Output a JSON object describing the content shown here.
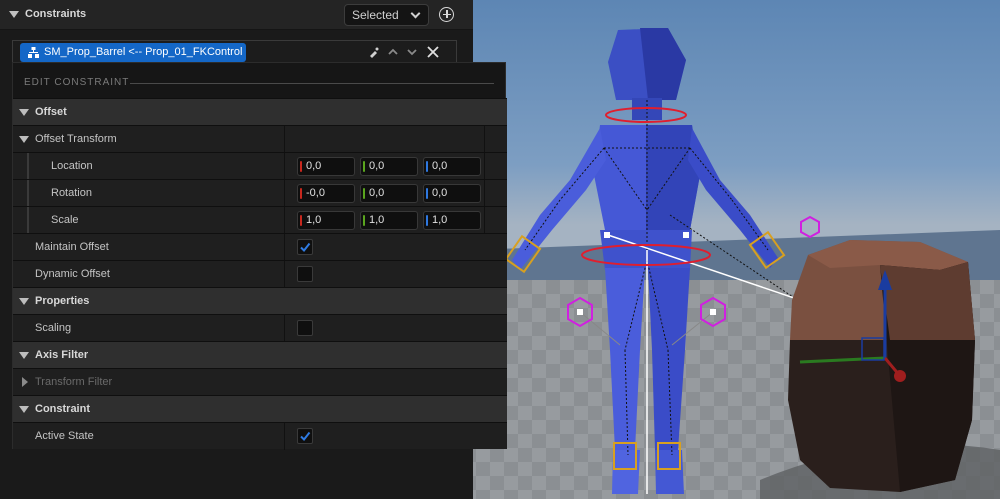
{
  "constraints_panel": {
    "title": "Constraints",
    "filter_dropdown": {
      "value": "Selected"
    },
    "add_icon": "plus-circle-icon",
    "constraint_item": {
      "label": "SM_Prop_Barrel <-- Prop_01_FKControl",
      "icon": "hierarchy-icon",
      "actions": [
        "bake-icon",
        "move-up-icon",
        "move-down-icon",
        "close-icon"
      ]
    }
  },
  "edit_constraint": {
    "title": "EDIT CONSTRAINT",
    "rows": [
      {
        "type": "category",
        "label": "Offset"
      },
      {
        "type": "group",
        "label": "Offset Transform"
      },
      {
        "type": "vector",
        "label": "Location",
        "x": "0,0",
        "y": "0,0",
        "z": "0,0"
      },
      {
        "type": "vector",
        "label": "Rotation",
        "x": "-0,0",
        "y": "0,0",
        "z": "0,0"
      },
      {
        "type": "vector",
        "label": "Scale",
        "x": "1,0",
        "y": "1,0",
        "z": "1,0"
      },
      {
        "type": "bool",
        "label": "Maintain Offset",
        "checked": true
      },
      {
        "type": "bool",
        "label": "Dynamic Offset",
        "checked": false
      },
      {
        "type": "category",
        "label": "Properties"
      },
      {
        "type": "bool",
        "label": "Scaling",
        "checked": false
      },
      {
        "type": "category",
        "label": "Axis Filter"
      },
      {
        "type": "collapsed",
        "label": "Transform Filter"
      },
      {
        "type": "category",
        "label": "Constraint"
      },
      {
        "type": "bool",
        "label": "Active State",
        "checked": true
      }
    ]
  },
  "colors": {
    "accent_blue": "#1467c7",
    "axis_x": "#c8281e",
    "axis_y": "#5aa51e",
    "axis_z": "#2e78e0",
    "checkbox_check": "#2f7be3"
  }
}
